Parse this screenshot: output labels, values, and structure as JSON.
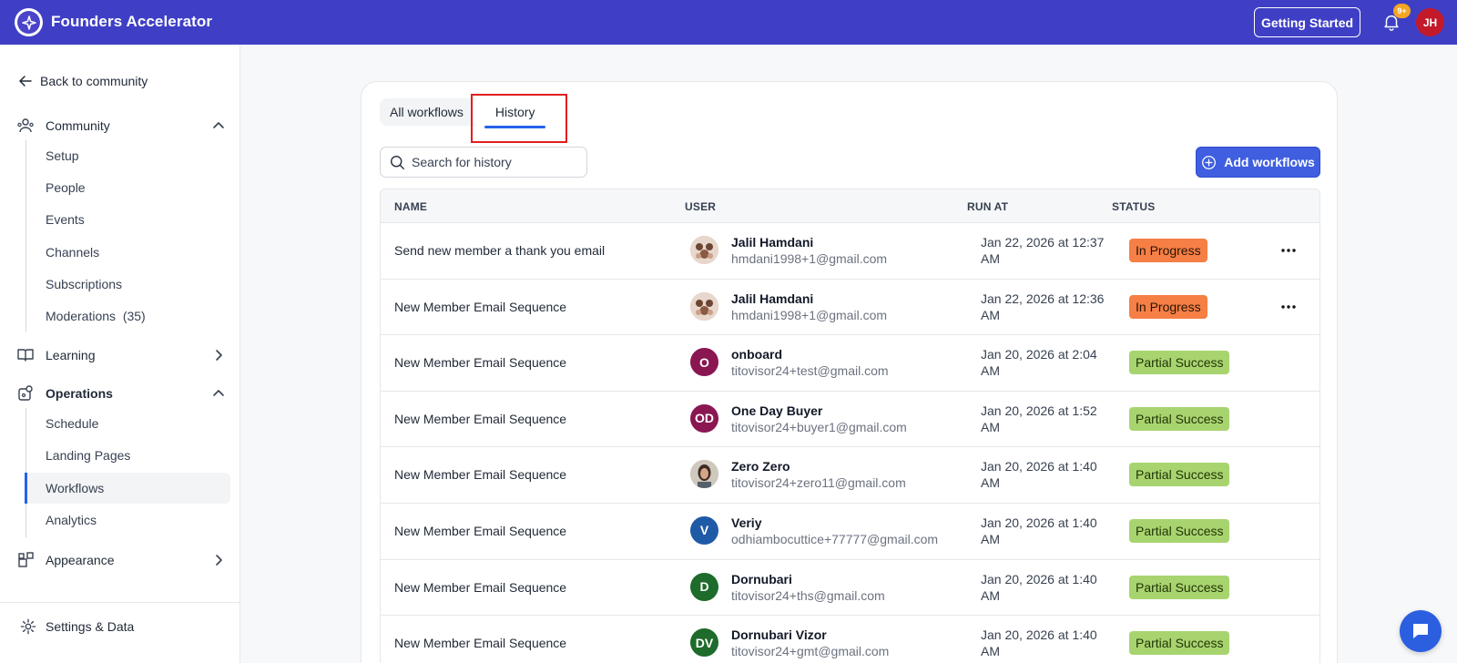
{
  "app": {
    "title": "Founders Accelerator",
    "getting_started": "Getting Started",
    "notification_count": "9+",
    "user_initials": "JH",
    "accent": "#3f3fc6"
  },
  "sidebar": {
    "back_label": "Back to community",
    "sections": {
      "community": {
        "label": "Community",
        "items": [
          "Setup",
          "People",
          "Events",
          "Channels",
          "Subscriptions",
          "Moderations  (35)"
        ]
      },
      "learning": {
        "label": "Learning"
      },
      "operations": {
        "label": "Operations",
        "items": [
          "Schedule",
          "Landing Pages",
          "Workflows",
          "Analytics"
        ]
      },
      "appearance": {
        "label": "Appearance"
      }
    },
    "settings_label": "Settings & Data"
  },
  "main": {
    "tabs": [
      "All workflows",
      "History"
    ],
    "active_tab": "History",
    "search_placeholder": "Search for history",
    "add_button": "Add workflows",
    "columns": [
      "NAME",
      "USER",
      "RUN AT",
      "STATUS"
    ],
    "rows": [
      {
        "name": "Send new member a thank you email",
        "user": "Jalil Hamdani",
        "email": "hmdani1998+1@gmail.com",
        "avatar": "photo",
        "run_at": "Jan 22, 2026 at 12:37 AM",
        "status": "In Progress"
      },
      {
        "name": "New Member Email Sequence",
        "user": "Jalil Hamdani",
        "email": "hmdani1998+1@gmail.com",
        "avatar": "photo",
        "run_at": "Jan 22, 2026 at 12:36 AM",
        "status": "In Progress"
      },
      {
        "name": "New Member Email Sequence",
        "user": "onboard",
        "email": "titovisor24+test@gmail.com",
        "avatar": "O",
        "avatar_color": "#8a1652",
        "run_at": "Jan 20, 2026 at 2:04 AM",
        "status": "Partial Success"
      },
      {
        "name": "New Member Email Sequence",
        "user": "One Day Buyer",
        "email": "titovisor24+buyer1@gmail.com",
        "avatar": "OD",
        "avatar_color": "#8a1652",
        "run_at": "Jan 20, 2026 at 1:52 AM",
        "status": "Partial Success"
      },
      {
        "name": "New Member Email Sequence",
        "user": "Zero Zero",
        "email": "titovisor24+zero11@gmail.com",
        "avatar": "photo2",
        "run_at": "Jan 20, 2026 at 1:40 AM",
        "status": "Partial Success"
      },
      {
        "name": "New Member Email Sequence",
        "user": "Veriy",
        "email": "odhiambocuttice+77777@gmail.com",
        "avatar": "V",
        "avatar_color": "#1f5aa6",
        "run_at": "Jan 20, 2026 at 1:40 AM",
        "status": "Partial Success"
      },
      {
        "name": "New Member Email Sequence",
        "user": "Dornubari",
        "email": "titovisor24+ths@gmail.com",
        "avatar": "D",
        "avatar_color": "#1e6b2b",
        "run_at": "Jan 20, 2026 at 1:40 AM",
        "status": "Partial Success"
      },
      {
        "name": "New Member Email Sequence",
        "user": "Dornubari Vizor",
        "email": "titovisor24+gmt@gmail.com",
        "avatar": "DV",
        "avatar_color": "#1e6b2b",
        "run_at": "Jan 20, 2026 at 1:40 AM",
        "status": "Partial Success"
      }
    ]
  },
  "icons": {
    "more": "more-horizontal-icon",
    "chat": "chat-icon"
  }
}
